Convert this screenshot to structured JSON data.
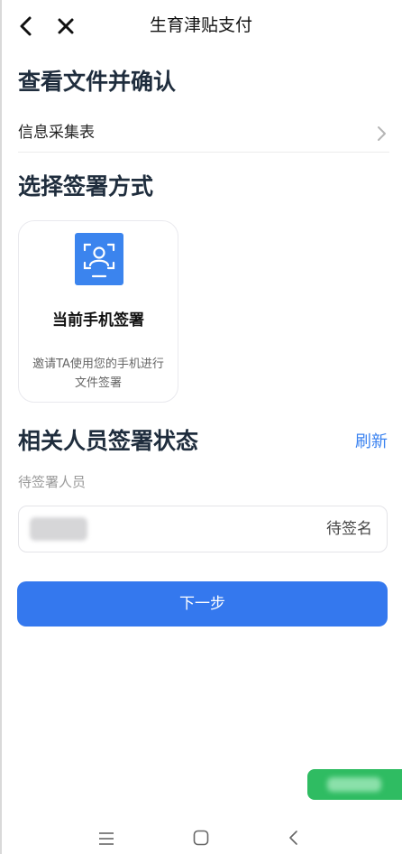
{
  "header": {
    "title": "生育津贴支付",
    "back_icon": "chevron-left-icon",
    "close_icon": "close-icon"
  },
  "file_section": {
    "title": "查看文件并确认",
    "items": [
      {
        "label": "信息采集表",
        "icon": "chevron-right-icon"
      }
    ]
  },
  "sign_section": {
    "title": "选择签署方式",
    "options": [
      {
        "icon": "face-recognition-icon",
        "title": "当前手机签署",
        "description": "邀请TA使用您的手机进行文件签署"
      }
    ]
  },
  "status_section": {
    "title": "相关人员签署状态",
    "refresh_label": "刷新",
    "pending_label": "待签署人员",
    "people": [
      {
        "name": "",
        "status": "待签名"
      }
    ]
  },
  "actions": {
    "next_label": "下一步"
  },
  "colors": {
    "primary": "#3478ee",
    "link": "#3a82f0",
    "title_text": "#1f2d3d",
    "float_button": "#2fbc62"
  },
  "system_nav": {
    "icons": [
      "menu-icon",
      "home-icon",
      "back-icon"
    ]
  }
}
